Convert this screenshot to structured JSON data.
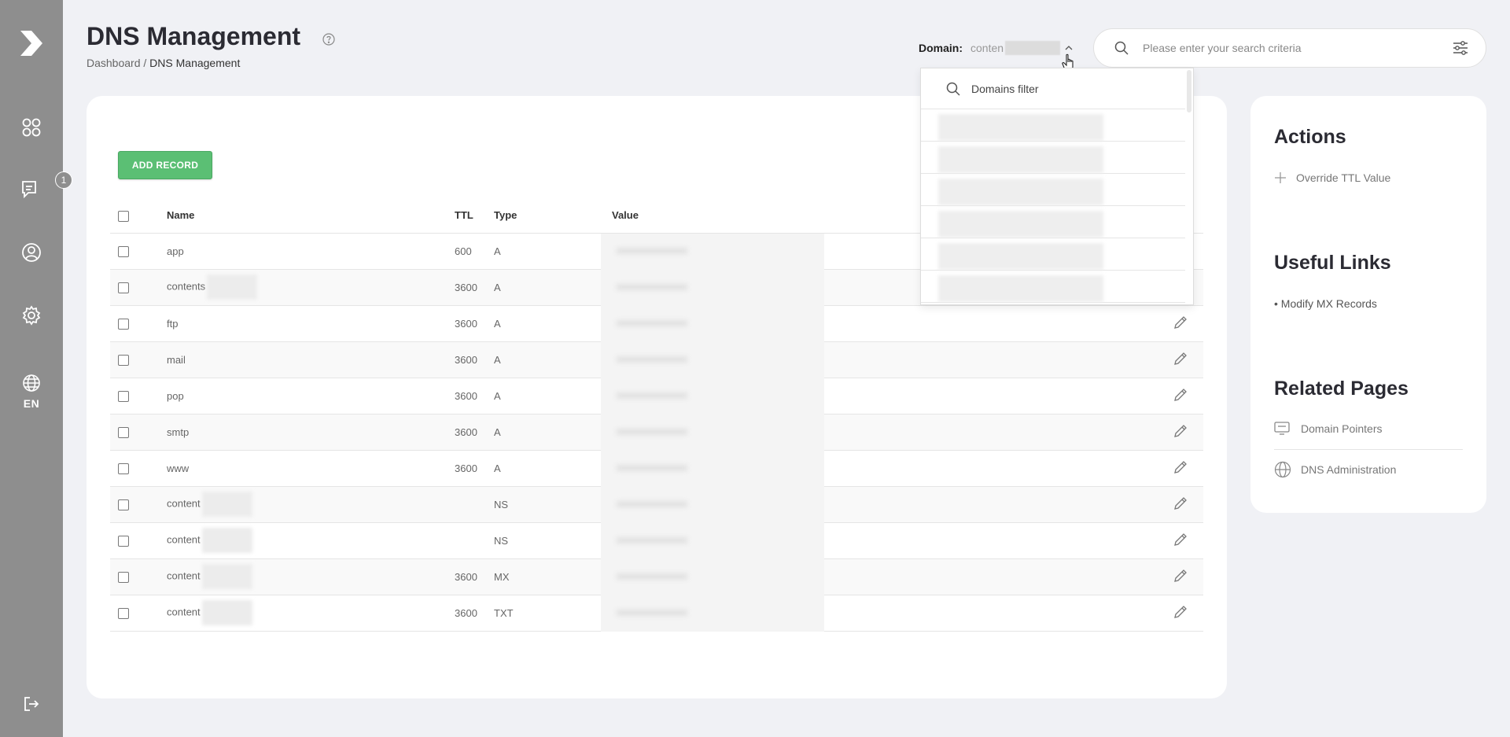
{
  "header": {
    "title": "DNS Management",
    "breadcrumb": {
      "root": "Dashboard",
      "separator": " / ",
      "current": "DNS Management"
    }
  },
  "domain_select": {
    "label": "Domain:",
    "value": "conten"
  },
  "search": {
    "placeholder": "Please enter your search criteria"
  },
  "sidebar": {
    "items": [
      {
        "name": "logo",
        "icon": "chevron-logo-icon"
      },
      {
        "name": "dashboard",
        "icon": "grid-icon"
      },
      {
        "name": "messages",
        "icon": "chat-icon",
        "badge": "1"
      },
      {
        "name": "account",
        "icon": "user-icon"
      },
      {
        "name": "settings",
        "icon": "gear-icon"
      },
      {
        "name": "language",
        "icon": "globe-icon",
        "label": "EN"
      },
      {
        "name": "logout",
        "icon": "logout-icon"
      }
    ]
  },
  "toolbar": {
    "add_label": "ADD RECORD"
  },
  "table": {
    "columns": {
      "name": "Name",
      "ttl": "TTL",
      "type": "Type",
      "value": "Value"
    },
    "rows": [
      {
        "name": "app",
        "ttl": "600",
        "type": "A",
        "value": ""
      },
      {
        "name": "contents",
        "ttl": "3600",
        "type": "A",
        "value": ""
      },
      {
        "name": "ftp",
        "ttl": "3600",
        "type": "A",
        "value": ""
      },
      {
        "name": "mail",
        "ttl": "3600",
        "type": "A",
        "value": ""
      },
      {
        "name": "pop",
        "ttl": "3600",
        "type": "A",
        "value": ""
      },
      {
        "name": "smtp",
        "ttl": "3600",
        "type": "A",
        "value": ""
      },
      {
        "name": "www",
        "ttl": "3600",
        "type": "A",
        "value": ""
      },
      {
        "name": "content",
        "ttl": "",
        "type": "NS",
        "value": ""
      },
      {
        "name": "content",
        "ttl": "",
        "type": "NS",
        "value": ""
      },
      {
        "name": "content",
        "ttl": "3600",
        "type": "MX",
        "value": ""
      },
      {
        "name": "content",
        "ttl": "3600",
        "type": "TXT",
        "value": ""
      }
    ]
  },
  "dropdown": {
    "filter_placeholder": "Domains filter",
    "item_count": 6
  },
  "right_panel": {
    "actions_title": "Actions",
    "override_ttl": "Override TTL Value",
    "links_title": "Useful Links",
    "modify_mx": "• Modify MX Records",
    "related_title": "Related Pages",
    "domain_pointers": "Domain Pointers",
    "dns_admin": "DNS Administration"
  },
  "colors": {
    "sidebar": "#8e8e8e",
    "accent_green": "#5bbf74",
    "background": "#f0f1f5"
  }
}
